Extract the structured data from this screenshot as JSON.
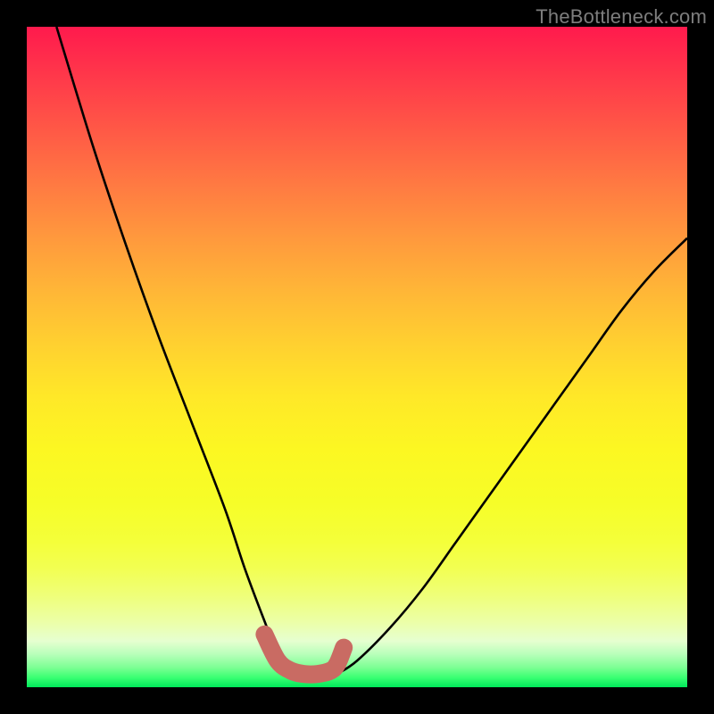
{
  "watermark": {
    "text": "TheBottleneck.com"
  },
  "chart_data": {
    "type": "line",
    "title": "",
    "xlabel": "",
    "ylabel": "",
    "xlim": [
      0,
      100
    ],
    "ylim": [
      0,
      100
    ],
    "series": [
      {
        "name": "left-curve",
        "x": [
          4.5,
          10,
          15,
          20,
          25,
          30,
          33,
          36,
          38,
          40
        ],
        "values": [
          100,
          82,
          67,
          53,
          40,
          27,
          18,
          10,
          5,
          2
        ]
      },
      {
        "name": "right-curve",
        "x": [
          47,
          50,
          55,
          60,
          65,
          70,
          75,
          80,
          85,
          90,
          95,
          100
        ],
        "values": [
          2,
          4,
          9,
          15,
          22,
          29,
          36,
          43,
          50,
          57,
          63,
          68
        ]
      },
      {
        "name": "valley-marker",
        "x": [
          36,
          38,
          40,
          42,
          44,
          46,
          47,
          48
        ],
        "values": [
          8,
          4,
          2.5,
          2,
          2,
          2.5,
          3.5,
          6
        ]
      }
    ],
    "colors": {
      "curve": "#000000",
      "marker": "#c96b63"
    },
    "background_gradient": {
      "top": "#ff1a4d",
      "mid": "#ffe828",
      "bottom": "#00e85a"
    }
  }
}
